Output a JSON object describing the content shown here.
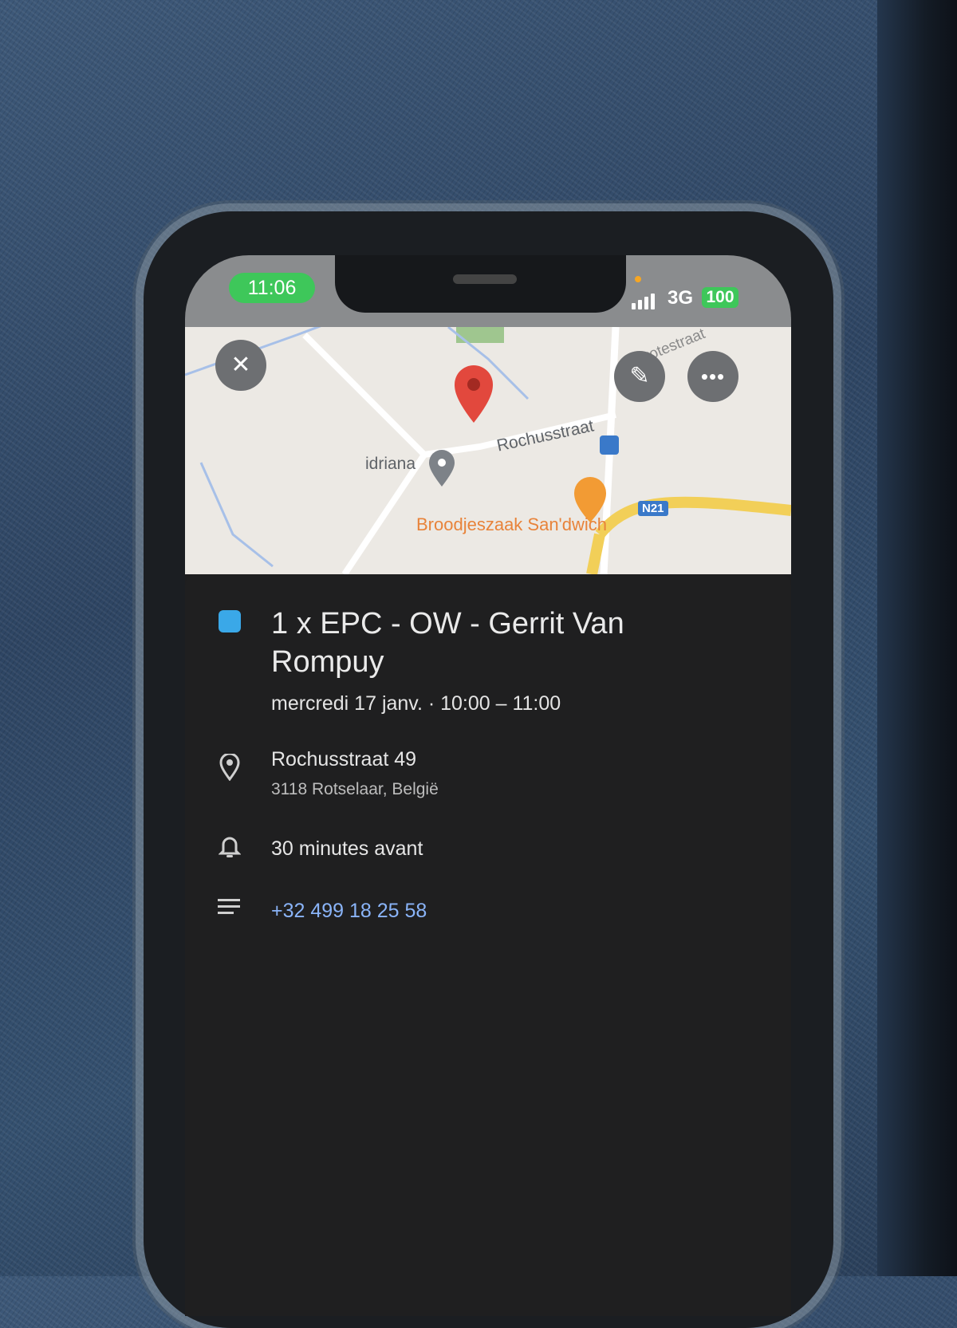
{
  "status_bar": {
    "time": "11:06",
    "network": "3G",
    "battery": "100",
    "colors": {
      "time_pill": "#3ec75a",
      "battery": "#3ec75a"
    }
  },
  "map": {
    "labels": {
      "place": "idriana",
      "street_main": "Rochusstraat",
      "street_side": "Grotestraat",
      "restaurant": "Broodjeszaak San'dwich",
      "road_badge": "N21"
    },
    "icons": [
      "close-icon",
      "pencil-icon",
      "more-icon",
      "red-map-pin-icon",
      "grey-map-pin-icon",
      "bus-stop-icon",
      "restaurant-pin-icon"
    ]
  },
  "event": {
    "color": "#3aa8e8",
    "title": "1 x EPC - OW - Gerrit Van Rompuy",
    "datetime": "mercredi 17 janv. · 10:00 – 11:00",
    "address_line1": "Rochusstraat 49",
    "address_line2": "3118 Rotselaar, België",
    "reminder": "30 minutes avant",
    "description_phone": "+32 499 18 25 58"
  }
}
